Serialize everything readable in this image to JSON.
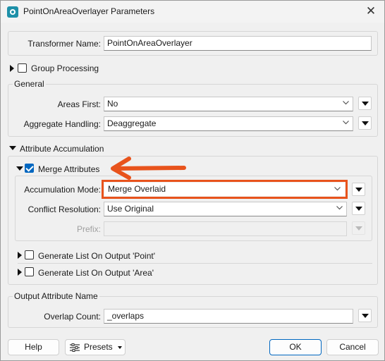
{
  "window": {
    "title": "PointOnAreaOverlayer Parameters",
    "close_glyph": "✕"
  },
  "transformer_name": {
    "label": "Transformer Name:",
    "value": "PointOnAreaOverlayer"
  },
  "group_processing": {
    "label": "Group Processing",
    "checked": false
  },
  "general": {
    "title": "General",
    "areas_first": {
      "label": "Areas First:",
      "value": "No"
    },
    "aggregate_handling": {
      "label": "Aggregate Handling:",
      "value": "Deaggregate"
    }
  },
  "attribute_accumulation": {
    "title": "Attribute Accumulation",
    "merge_attributes": {
      "label": "Merge Attributes",
      "checked": true
    },
    "accumulation_mode": {
      "label": "Accumulation Mode:",
      "value": "Merge Overlaid"
    },
    "conflict_resolution": {
      "label": "Conflict Resolution:",
      "value": "Use Original"
    },
    "prefix": {
      "label": "Prefix:",
      "value": ""
    },
    "list_point": {
      "label": "Generate List On Output 'Point'",
      "checked": false
    },
    "list_area": {
      "label": "Generate List On Output 'Area'",
      "checked": false
    }
  },
  "output_attribute_name": {
    "title": "Output Attribute Name",
    "overlap_count": {
      "label": "Overlap Count:",
      "value": "_overlaps"
    }
  },
  "footer": {
    "help": "Help",
    "presets": "Presets",
    "ok": "OK",
    "cancel": "Cancel"
  },
  "colors": {
    "highlight": "#e8531c",
    "accent": "#0067c0"
  },
  "icons": {
    "app": "fme-transformer-icon",
    "annotation": "arrow-left-annotation-icon"
  }
}
